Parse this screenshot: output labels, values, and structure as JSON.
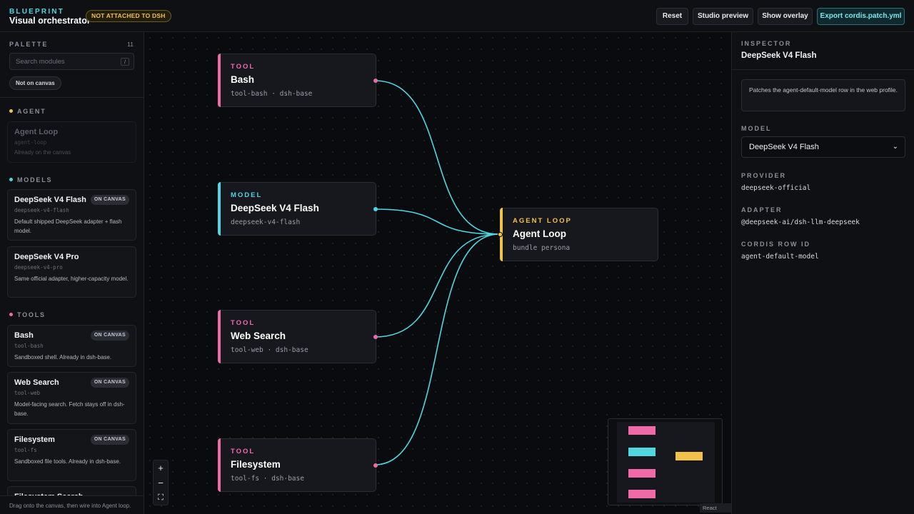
{
  "header": {
    "kicker": "BLUEPRINT",
    "title": "Visual orchestrator",
    "status_badge": "NOT ATTACHED TO DSH",
    "buttons": {
      "reset": "Reset",
      "studio_preview": "Studio preview",
      "show_overlay": "Show overlay",
      "export": "Export cordis.patch.yml"
    }
  },
  "palette": {
    "heading": "PALETTE",
    "count": "11",
    "search_placeholder": "Search modules",
    "search_shortcut": "/",
    "filter_chip": "Not on canvas",
    "sections": {
      "agent": {
        "label": "AGENT",
        "color": "#f2c14a",
        "cards": [
          {
            "title": "Agent Loop",
            "id": "agent-loop",
            "desc": "Already on the canvas"
          }
        ]
      },
      "models": {
        "label": "MODELS",
        "color": "#4fd6de",
        "cards": [
          {
            "title": "DeepSeek V4 Flash",
            "id": "deepseek-v4-flash",
            "desc": "Default shipped DeepSeek adapter + flash model.",
            "badge": "ON CANVAS"
          },
          {
            "title": "DeepSeek V4 Pro",
            "id": "deepseek-v4-pro",
            "desc": "Same official adapter, higher-capacity model."
          }
        ]
      },
      "tools": {
        "label": "TOOLS",
        "color": "#f06aa8",
        "cards": [
          {
            "title": "Bash",
            "id": "tool-bash",
            "desc": "Sandboxed shell. Already in dsh-base.",
            "badge": "ON CANVAS"
          },
          {
            "title": "Web Search",
            "id": "tool-web",
            "desc": "Model-facing search. Fetch stays off in dsh-base.",
            "badge": "ON CANVAS"
          },
          {
            "title": "Filesystem",
            "id": "tool-fs",
            "desc": "Sandboxed file tools. Already in dsh-base.",
            "badge": "ON CANVAS"
          },
          {
            "title": "Filesystem Search"
          }
        ]
      }
    },
    "footer_hint": "Drag onto the canvas, then wire into Agent loop."
  },
  "canvas": {
    "nodes": {
      "bash": {
        "kicker": "TOOL",
        "title": "Bash",
        "sub": "tool-bash · dsh-base",
        "color": "#f06aa8"
      },
      "model": {
        "kicker": "MODEL",
        "title": "DeepSeek V4 Flash",
        "sub": "deepseek-v4-flash",
        "color": "#4fd6de"
      },
      "web": {
        "kicker": "TOOL",
        "title": "Web Search",
        "sub": "tool-web · dsh-base",
        "color": "#f06aa8"
      },
      "fs": {
        "kicker": "TOOL",
        "title": "Filesystem",
        "sub": "tool-fs · dsh-base",
        "color": "#f06aa8"
      },
      "agent": {
        "kicker": "AGENT LOOP",
        "title": "Agent Loop",
        "sub": "bundle persona",
        "color": "#f2c14a"
      }
    },
    "edge_color": "#4fd6de",
    "zoom_controls": {
      "zoom_in": "+",
      "zoom_out": "−",
      "fit": "⛶"
    },
    "attribution": "React Flow"
  },
  "inspector": {
    "heading": "INSPECTOR",
    "title": "DeepSeek V4 Flash",
    "note": "Patches the agent-default-model row in the web profile.",
    "model_label": "MODEL",
    "model_value": "DeepSeek V4 Flash",
    "provider_label": "PROVIDER",
    "provider_value": "deepseek-official",
    "adapter_label": "ADAPTER",
    "adapter_value": "@deepseek-ai/dsh-llm-deepseek",
    "row_label": "CORDIS ROW ID",
    "row_value": "agent-default-model"
  }
}
